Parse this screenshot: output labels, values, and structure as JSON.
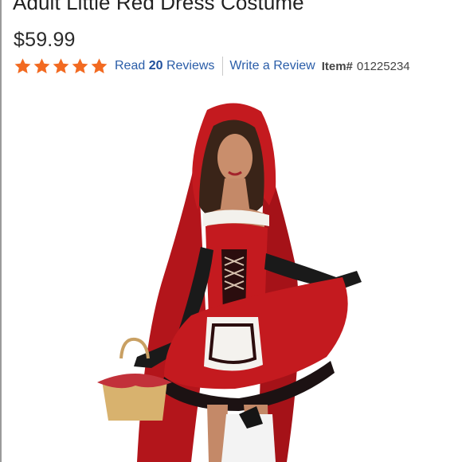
{
  "product": {
    "title": "Adult Little Red Dress Costume",
    "price": "$59.99",
    "rating_stars": 5,
    "reviews_prefix": "Read",
    "reviews_count": "20",
    "reviews_suffix": "Reviews",
    "write_review": "Write a Review",
    "item_label": "Item#",
    "item_number": "01225234"
  },
  "icons": {
    "star": "star-icon"
  },
  "colors": {
    "star": "#f26a21",
    "link": "#2a5da8",
    "costume_red": "#c41a1f"
  }
}
